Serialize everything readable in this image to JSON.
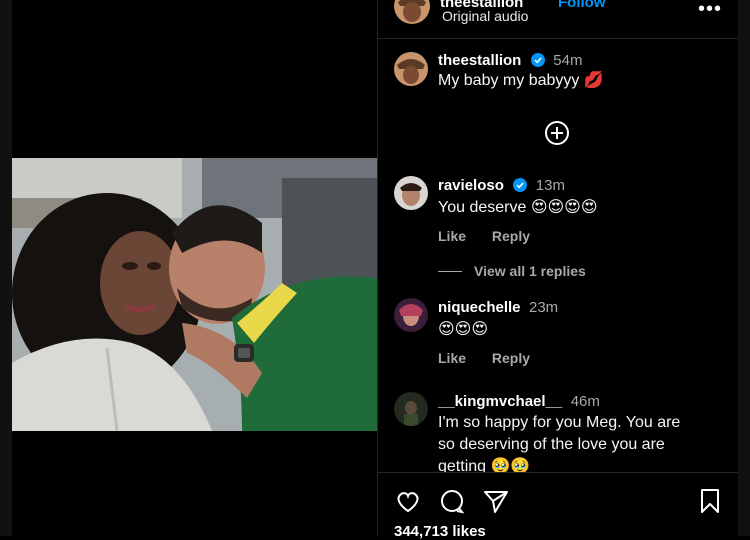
{
  "header": {
    "username": "theestallion",
    "follow_label": "Follow",
    "audio": "Original audio",
    "more_label": "•••"
  },
  "caption": {
    "username": "theestallion",
    "time": "54m",
    "text": "My baby my babyyy 💋"
  },
  "comments": [
    {
      "username": "ravieloso",
      "time": "13m",
      "verified": true,
      "text": "You deserve 😍😍😍😍",
      "like_label": "Like",
      "reply_label": "Reply",
      "view_replies": "View all 1 replies"
    },
    {
      "username": "niquechelle",
      "time": "23m",
      "verified": false,
      "text": "😍😍😍",
      "like_label": "Like",
      "reply_label": "Reply"
    },
    {
      "username": "__kingmvchael__",
      "time": "46m",
      "verified": false,
      "text_lines": [
        "I'm so happy for you Meg. You are",
        "so deserving of the love you are",
        "getting 🥹🥹"
      ]
    }
  ],
  "footer": {
    "likes": "344,713 likes"
  },
  "colors": {
    "background": "#000000",
    "accent_blue": "#0095f6",
    "secondary_text": "#a8a8a8",
    "divider": "#262626"
  },
  "icons": [
    "plus-circle-icon",
    "heart-icon",
    "comment-icon",
    "share-icon",
    "bookmark-icon",
    "verified-badge-icon",
    "more-icon"
  ]
}
